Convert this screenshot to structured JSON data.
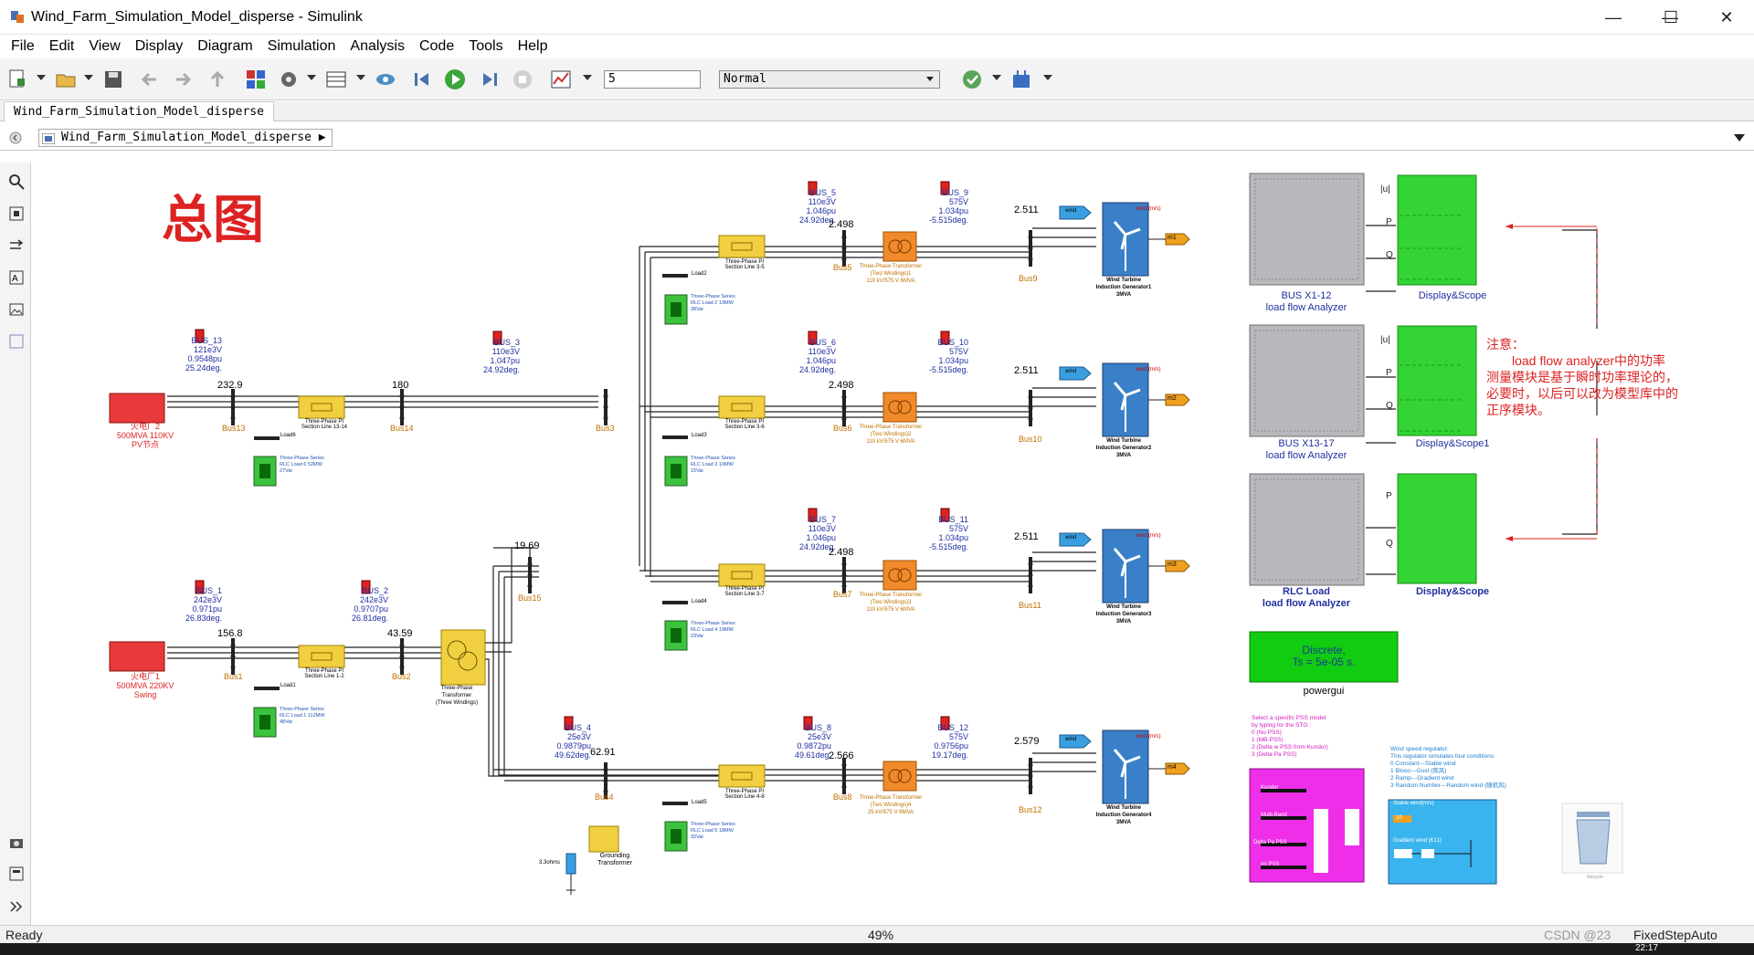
{
  "window": {
    "title": "Wind_Farm_Simulation_Model_disperse - Simulink",
    "minimize": "—",
    "maximize": "☐",
    "close": "✕"
  },
  "menu": [
    "File",
    "Edit",
    "View",
    "Display",
    "Diagram",
    "Simulation",
    "Analysis",
    "Code",
    "Tools",
    "Help"
  ],
  "toolbar": {
    "stop_time": "5",
    "sim_mode": "Normal"
  },
  "tab": {
    "label": "Wind_Farm_Simulation_Model_disperse"
  },
  "address": {
    "path": "Wind_Farm_Simulation_Model_disperse",
    "arrow": "▶"
  },
  "canvas": {
    "big_title": "总图",
    "generators": [
      {
        "name": "火电厂2",
        "line2": "500MVA 110KV",
        "line3": "PV节点"
      },
      {
        "name": "火电厂1",
        "line2": "500MVA 220KV",
        "line3": "Swing"
      }
    ],
    "measures": [
      {
        "bus": "BUS_13",
        "v": "121e3V",
        "pu": "0.9548pu",
        "deg": "25.24deg."
      },
      {
        "bus": "BUS_3",
        "v": "110e3V",
        "pu": "1.047pu",
        "deg": "24.92deg."
      },
      {
        "bus": "BUS_1",
        "v": "242e3V",
        "pu": "0.971pu",
        "deg": "26.83deg."
      },
      {
        "bus": "BUS_2",
        "v": "242e3V",
        "pu": "0.9707pu",
        "deg": "26.81deg."
      },
      {
        "bus": "BUS_4",
        "v": "25e3V",
        "pu": "0.9879pu",
        "deg": "49.62deg."
      },
      {
        "bus": "BUS_5",
        "v": "110e3V",
        "pu": "1.046pu",
        "deg": "24.92deg."
      },
      {
        "bus": "BUS_6",
        "v": "110e3V",
        "pu": "1.046pu",
        "deg": "24.92deg."
      },
      {
        "bus": "BUS_7",
        "v": "110e3V",
        "pu": "1.046pu",
        "deg": "24.92deg."
      },
      {
        "bus": "BUS_8",
        "v": "25e3V",
        "pu": "0.9872pu",
        "deg": "49.61deg."
      },
      {
        "bus": "BUS_9",
        "v": "575V",
        "pu": "1.034pu",
        "deg": "-5.515deg."
      },
      {
        "bus": "BUS_10",
        "v": "575V",
        "pu": "1.034pu",
        "deg": "-5.515deg."
      },
      {
        "bus": "BUS_11",
        "v": "575V",
        "pu": "1.034pu",
        "deg": "-5.515deg."
      },
      {
        "bus": "BUS_12",
        "v": "575V",
        "pu": "0.9756pu",
        "deg": "19.17deg."
      }
    ],
    "bus_labels": [
      "Bus13",
      "Bus14",
      "Bus3",
      "Bus1",
      "Bus2",
      "Bus15",
      "Bus4",
      "Bus5",
      "Bus6",
      "Bus7",
      "Bus8",
      "Bus9",
      "Bus10",
      "Bus11",
      "Bus12"
    ],
    "flows": [
      "232.9",
      "180",
      "156.8",
      "43.59",
      "19.69",
      "62.91",
      "2.498",
      "2.498",
      "2.498",
      "2.566",
      "2.511",
      "2.511",
      "2.511",
      "2.579"
    ],
    "line_labels": [
      "Three-Phase PI Section Line 13-14",
      "Three-Phase PI Section Line 1-2",
      "Three-Phase PI Section Line 3-5",
      "Three-Phase PI Section Line 3-6",
      "Three-Phase PI Section Line 3-7",
      "Three-Phase PI Section Line 4-8"
    ],
    "load_labels": [
      "Load6",
      "Load1",
      "Load2",
      "Load3",
      "Load4",
      "Load5"
    ],
    "rlc_labels": [
      "Three-Phase Series RLC Load 6  52MW 27Var",
      "Three-Phase Series RLC Load 1  112MW 48Var",
      "Three-Phase Series RLC Load 2  19MW 38Var",
      "Three-Phase Series RLC Load 3  10MW 15Var",
      "Three-Phase Series RLC Load 4  19MW 23Var",
      "Three-Phase Series RLC Load 5  18MW 32Var"
    ],
    "transformers": [
      {
        "l1": "Three-Phase Transformer",
        "l2": "(Two Windings)1",
        "l3": "110 kV/575 V  6MVA"
      },
      {
        "l1": "Three-Phase Transformer",
        "l2": "(Two Windings)2",
        "l3": "110 kV/575 V  6MVA"
      },
      {
        "l1": "Three-Phase Transformer",
        "l2": "(Two Windings)3",
        "l3": "110 kV/575 V  6MVA"
      },
      {
        "l1": "Three-Phase Transformer",
        "l2": "(Two Windings)4",
        "l3": "25 kV/575 V  6MVA"
      }
    ],
    "three_winding": {
      "l1": "Three-Phase",
      "l2": "Transformer",
      "l3": "(Three Windings)"
    },
    "grounding": {
      "l1": "Grounding",
      "l2": "Transformer",
      "res": "3.3ohms"
    },
    "turbines": [
      {
        "l1": "Wind Turbine",
        "l2": "Induction Generator1",
        "l3": "3MVA",
        "out": "m1"
      },
      {
        "l1": "Wind Turbine",
        "l2": "Induction Generator2",
        "l3": "3MVA",
        "out": "m2"
      },
      {
        "l1": "Wind Turbine",
        "l2": "Induction Generator3",
        "l3": "3MVA",
        "out": "m3"
      },
      {
        "l1": "Wind Turbine",
        "l2": "Induction Generator4",
        "l3": "3MVA",
        "out": "m4"
      }
    ],
    "wind_port": "wind (m/s)",
    "wind_tag": "wind",
    "analyzers": [
      {
        "l1": "BUS X1-12",
        "l2": "load flow Analyzer"
      },
      {
        "l1": "BUS X13-17",
        "l2": "load flow Analyzer"
      },
      {
        "l1": "RLC Load",
        "l2": "load flow Analyzer"
      }
    ],
    "scopes": [
      "Display&Scope",
      "Display&Scope1",
      "Display&Scope"
    ],
    "ports": {
      "u": "|u|",
      "p": "P",
      "q": "Q"
    },
    "note": {
      "title": "注意：",
      "body": "load flow analyzer中的功率测量模块是基于瞬时功率理论的，必要时，以后可以改为模型库中的正序模块。"
    },
    "powergui": {
      "l1": "Discrete,",
      "l2": "Ts = 5e-05 s.",
      "name": "powergui"
    },
    "pss_text": [
      "Select a specific PSS model",
      "by typing for the STG :",
      "0  (No PSS)",
      "1  (MB-PSS)",
      "2  (Delta w PSS from Kundur)",
      "3  (Delta Pa PSS)"
    ],
    "pss_block": {
      "a": "Kundur",
      "b": "Multi-Band",
      "c": "Delta Pa PSS",
      "d": "no PSS"
    },
    "wind_reg_text": [
      "Wind speed regulator:",
      "This regulator simulates four conditions",
      "0  Constant---Stable wind",
      "1  Blooo---Gust (阵风)",
      "2  Ramp---Gradient wind",
      "3  Random Number---Random wind (随机风)"
    ],
    "wind_block": {
      "a": "Stable wind(m/s)",
      "v": "10",
      "b": "Gradient wind (K11)"
    },
    "recycle_label": "Recycle"
  },
  "status": {
    "left": "Ready",
    "center": "49%",
    "right": "FixedStepAuto",
    "watermark": "CSDN @23",
    "time": "22:17"
  },
  "colors": {
    "bus": "#c07000",
    "meas": "#2030a0",
    "gen": "#d02020",
    "line": "#000000"
  }
}
